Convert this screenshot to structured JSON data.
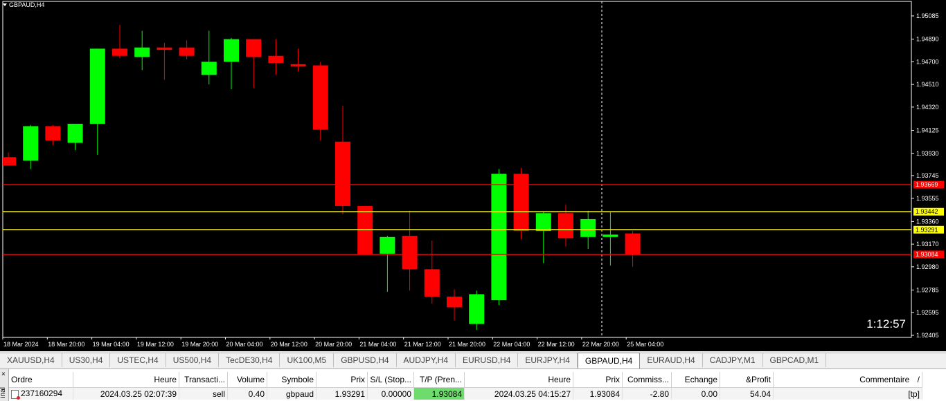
{
  "chart": {
    "title": "GBPAUD,H4",
    "timer": "1:12:57",
    "price_axis": [
      "1.95085",
      "1.94890",
      "1.94700",
      "1.94510",
      "1.94320",
      "1.94125",
      "1.93930",
      "1.93745",
      "1.93555",
      "1.93360",
      "1.93170",
      "1.92980",
      "1.92785",
      "1.92595",
      "1.92405"
    ],
    "time_axis": [
      "18 Mar 2024",
      "18 Mar 20:00",
      "19 Mar 04:00",
      "19 Mar 12:00",
      "19 Mar 20:00",
      "20 Mar 04:00",
      "20 Mar 12:00",
      "20 Mar 20:00",
      "21 Mar 04:00",
      "21 Mar 12:00",
      "21 Mar 20:00",
      "22 Mar 04:00",
      "22 Mar 12:00",
      "22 Mar 20:00",
      "25 Mar 04:00"
    ],
    "levels": [
      {
        "price": 1.93669,
        "label": "1.93669",
        "color": "#ff0000",
        "text_color": "#ffffff"
      },
      {
        "price": 1.93442,
        "label": "1.93442",
        "color": "#ffff00",
        "text_color": "#000000"
      },
      {
        "price": 1.93291,
        "label": "1.93291",
        "color": "#ffff00",
        "text_color": "#000000"
      },
      {
        "price": 1.93084,
        "label": "1.93084",
        "color": "#ff0000",
        "text_color": "#ffffff"
      }
    ],
    "colors": {
      "bull": "#00ff00",
      "bear": "#ff0000",
      "axis": "#ffffff",
      "background": "#000000"
    }
  },
  "chart_data": {
    "type": "candlestick",
    "title": "GBPAUD,H4",
    "ylim": [
      1.92405,
      1.95085
    ],
    "candles": [
      {
        "o": 1.939,
        "h": 1.9394,
        "l": 1.9383,
        "c": 1.9383
      },
      {
        "o": 1.9387,
        "h": 1.9417,
        "l": 1.938,
        "c": 1.9416
      },
      {
        "o": 1.9416,
        "h": 1.9417,
        "l": 1.94,
        "c": 1.9404
      },
      {
        "o": 1.9402,
        "h": 1.9418,
        "l": 1.9396,
        "c": 1.9418
      },
      {
        "o": 1.9418,
        "h": 1.9481,
        "l": 1.9392,
        "c": 1.9481
      },
      {
        "o": 1.9481,
        "h": 1.9501,
        "l": 1.9473,
        "c": 1.9475
      },
      {
        "o": 1.9474,
        "h": 1.9496,
        "l": 1.9463,
        "c": 1.9482
      },
      {
        "o": 1.9482,
        "h": 1.9486,
        "l": 1.9455,
        "c": 1.948
      },
      {
        "o": 1.9482,
        "h": 1.9488,
        "l": 1.9472,
        "c": 1.9475
      },
      {
        "o": 1.9459,
        "h": 1.9496,
        "l": 1.9451,
        "c": 1.947
      },
      {
        "o": 1.947,
        "h": 1.949,
        "l": 1.9447,
        "c": 1.9489
      },
      {
        "o": 1.9489,
        "h": 1.9489,
        "l": 1.9448,
        "c": 1.9474
      },
      {
        "o": 1.9475,
        "h": 1.9489,
        "l": 1.9459,
        "c": 1.9469
      },
      {
        "o": 1.9468,
        "h": 1.9481,
        "l": 1.9462,
        "c": 1.9466
      },
      {
        "o": 1.9467,
        "h": 1.947,
        "l": 1.9404,
        "c": 1.9413
      },
      {
        "o": 1.9403,
        "h": 1.9433,
        "l": 1.9342,
        "c": 1.9349
      },
      {
        "o": 1.9349,
        "h": 1.9349,
        "l": 1.9308,
        "c": 1.9308
      },
      {
        "o": 1.9309,
        "h": 1.9324,
        "l": 1.9277,
        "c": 1.9323
      },
      {
        "o": 1.9324,
        "h": 1.9345,
        "l": 1.9278,
        "c": 1.9296
      },
      {
        "o": 1.9296,
        "h": 1.932,
        "l": 1.9267,
        "c": 1.9273
      },
      {
        "o": 1.9273,
        "h": 1.9279,
        "l": 1.9253,
        "c": 1.9264
      },
      {
        "o": 1.925,
        "h": 1.9278,
        "l": 1.9245,
        "c": 1.9275
      },
      {
        "o": 1.927,
        "h": 1.938,
        "l": 1.9266,
        "c": 1.9376
      },
      {
        "o": 1.9376,
        "h": 1.9381,
        "l": 1.9321,
        "c": 1.9328
      },
      {
        "o": 1.9328,
        "h": 1.9344,
        "l": 1.9301,
        "c": 1.9343
      },
      {
        "o": 1.9343,
        "h": 1.935,
        "l": 1.9315,
        "c": 1.9322
      },
      {
        "o": 1.9323,
        "h": 1.9345,
        "l": 1.9313,
        "c": 1.9338
      },
      {
        "o": 1.9323,
        "h": 1.9344,
        "l": 1.9299,
        "c": 1.9325
      },
      {
        "o": 1.9326,
        "h": 1.9328,
        "l": 1.9298,
        "c": 1.9308
      }
    ]
  },
  "tabs": [
    "XAUUSD,H4",
    "US30,H4",
    "USTEC,H4",
    "US500,H4",
    "TecDE30,H4",
    "UK100,M5",
    "GBPUSD,H4",
    "AUDJPY,H4",
    "EURUSD,H4",
    "EURJPY,H4",
    "GBPAUD,H4",
    "EURAUD,H4",
    "CADJPY,M1",
    "GBPCAD,M1"
  ],
  "active_tab": "GBPAUD,H4",
  "terminal": {
    "side_label": "inal",
    "close": "×",
    "headers": [
      "Ordre",
      "Heure",
      "Transacti...",
      "Volume",
      "Symbole",
      "Prix",
      "S/L (Stop...",
      "T/P (Pren...",
      "Heure",
      "Prix",
      "Commiss...",
      "Echange",
      "&Profit",
      "Commentaire"
    ],
    "sort_indicator": "/",
    "row": {
      "order": "237160294",
      "open_time": "2024.03.25 02:07:39",
      "type": "sell",
      "volume": "0.40",
      "symbol": "gbpaud",
      "price": "1.93291",
      "sl": "0.00000",
      "tp": "1.93084",
      "time": "2024.03.25 04:15:27",
      "current_price": "1.93084",
      "commission": "-2.80",
      "swap": "0.00",
      "profit": "54.04",
      "comment": "[tp]"
    }
  }
}
